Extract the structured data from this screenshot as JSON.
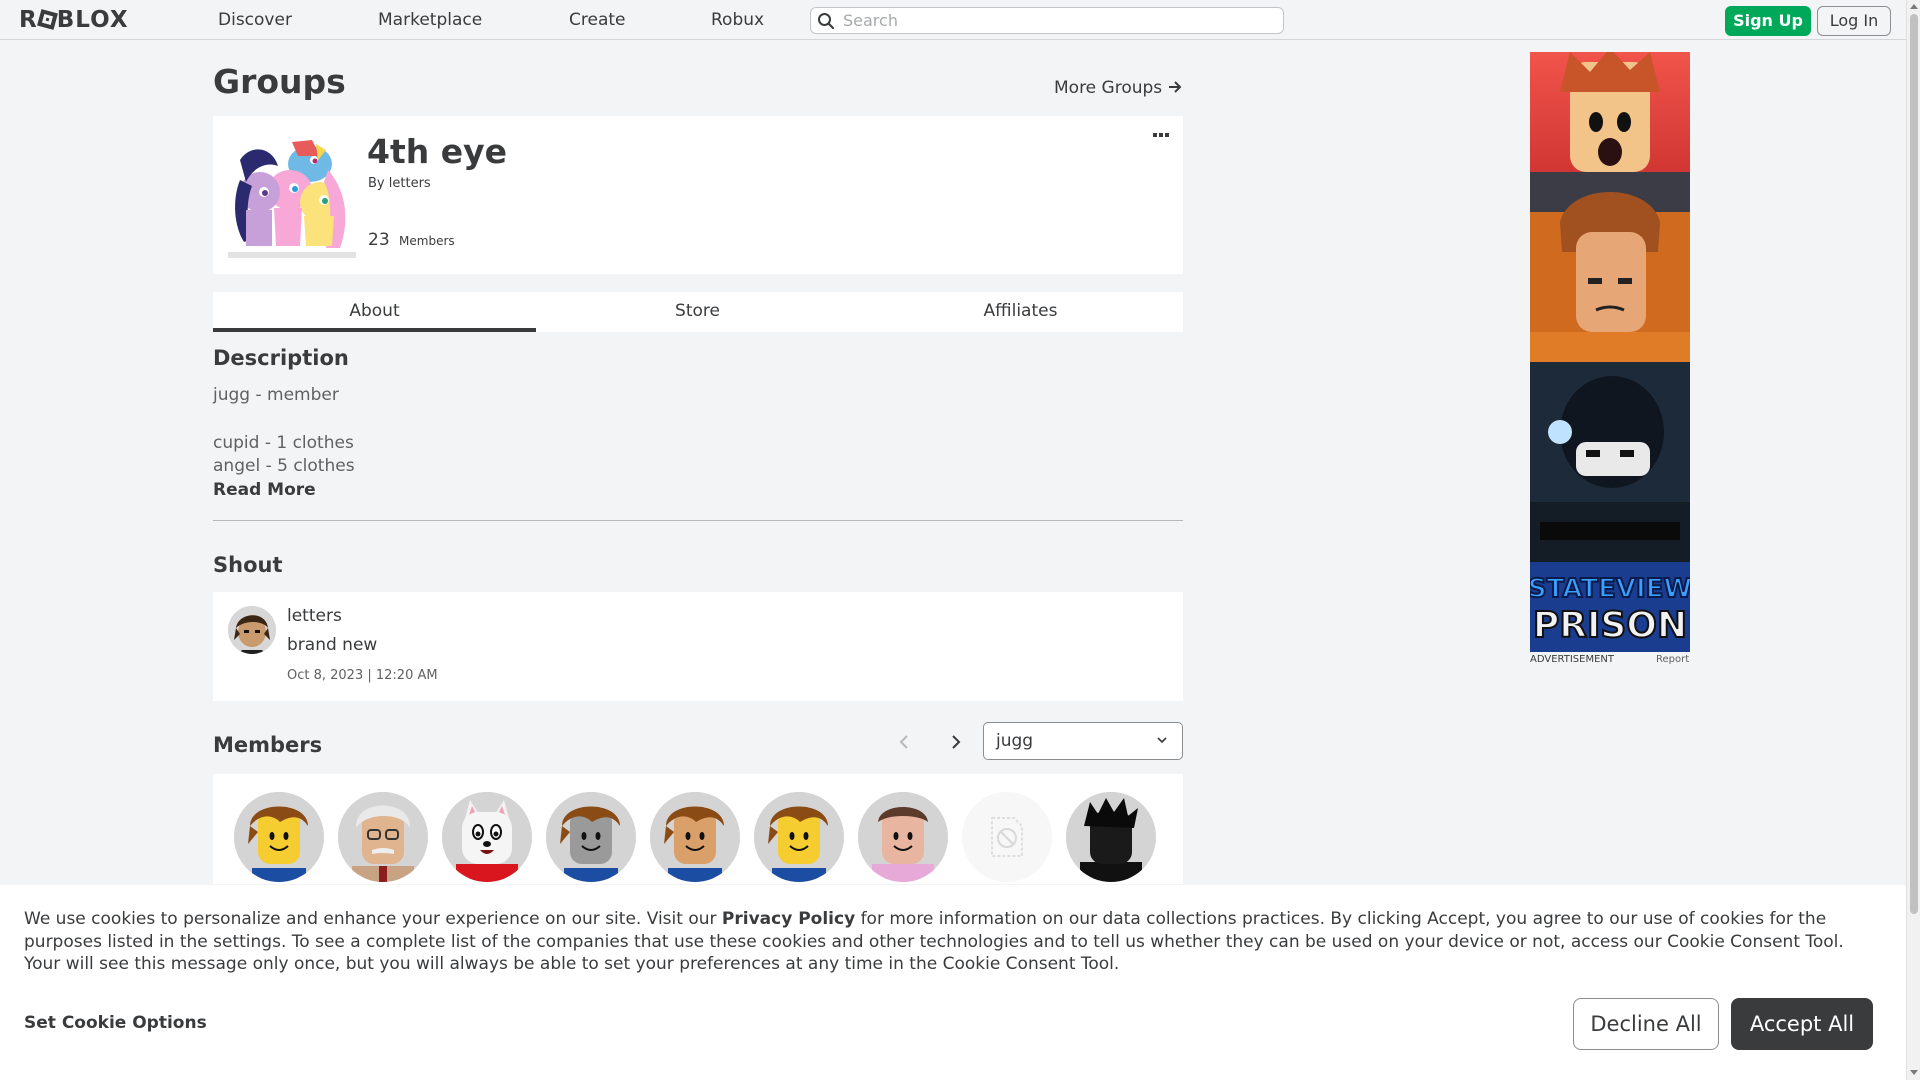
{
  "nav": {
    "logo": "ROBLOX",
    "links": [
      "Discover",
      "Marketplace",
      "Create",
      "Robux"
    ],
    "search_placeholder": "Search",
    "signup_label": "Sign Up",
    "login_label": "Log In"
  },
  "page": {
    "title": "Groups",
    "more_groups": "More Groups"
  },
  "group": {
    "name": "4th eye",
    "by_label": "By",
    "owner": "letters",
    "member_count": "23",
    "members_label": "Members"
  },
  "tabs": [
    "About",
    "Store",
    "Affiliates"
  ],
  "active_tab": "About",
  "description": {
    "title": "Description",
    "lines": [
      "jugg - member",
      "cupid - 1 clothes",
      "angel - 5 clothes"
    ],
    "read_more": "Read More"
  },
  "shout": {
    "title": "Shout",
    "user": "letters",
    "body": "brand new",
    "date": "Oct 8, 2023 | 12:20 AM"
  },
  "members": {
    "title": "Members",
    "role_selected": "jugg",
    "thumbnails": [
      {
        "type": "classic",
        "shirt": "#1b4ea3"
      },
      {
        "type": "old-man",
        "shirt": "#c7a383"
      },
      {
        "type": "dog",
        "shirt": "#d9151e"
      },
      {
        "type": "classic-gray",
        "shirt": "#1b4ea3"
      },
      {
        "type": "classic-tan",
        "shirt": "#1b4ea3"
      },
      {
        "type": "classic",
        "shirt": "#1b4ea3"
      },
      {
        "type": "pink",
        "shirt": "#e7a9d8"
      },
      {
        "type": "blocked",
        "shirt": ""
      },
      {
        "type": "dark",
        "shirt": "#111111"
      }
    ]
  },
  "ad": {
    "label": "ADVERTISEMENT",
    "report": "Report",
    "text_line1": "STATEVIEW",
    "text_line2": "PRISON"
  },
  "cookie": {
    "text_before": "We use cookies to personalize and enhance your experience on our site. Visit our ",
    "privacy_link": "Privacy Policy",
    "text_after": " for more information on our data collections practices. By clicking Accept, you agree to our use of cookies for the purposes listed in the settings. To see a complete list of the companies that use these cookies and other technologies and to tell us whether they can be used on your device or not, access our Cookie Consent Tool. Your will see this message only once, but you will always be able to set your preferences at any time in the Cookie Consent Tool.",
    "set_options": "Set Cookie Options",
    "decline": "Decline All",
    "accept": "Accept All"
  },
  "colors": {
    "brand_green": "#00a85a",
    "text": "#393b3d",
    "page_bg": "#f2f4f5"
  }
}
